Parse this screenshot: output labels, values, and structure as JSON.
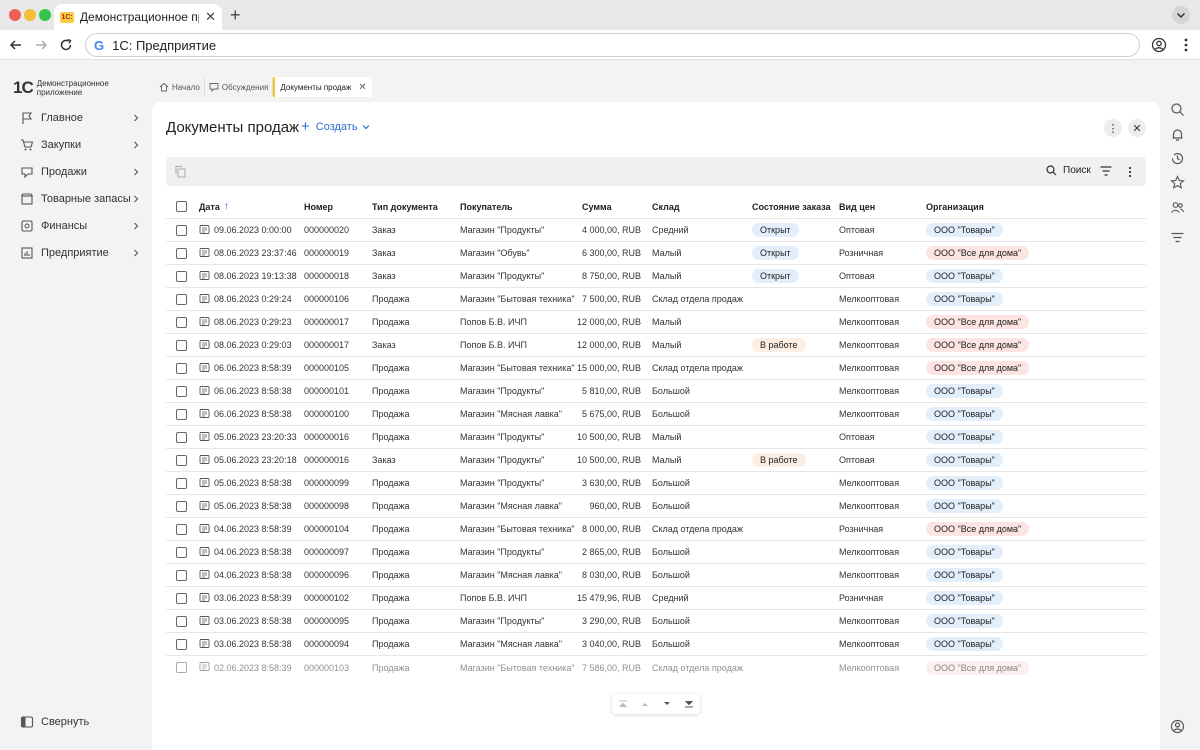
{
  "browser": {
    "tab_title": "Демонстрационное приложение",
    "favicon_text": "1С:",
    "url": "1С: Предприятие"
  },
  "sidebar": {
    "logo_mark": "1С",
    "logo_text": "Демонстрационное приложение",
    "items": [
      {
        "label": "Главное",
        "icon": "flag-icon"
      },
      {
        "label": "Закупки",
        "icon": "cart-icon"
      },
      {
        "label": "Продажи",
        "icon": "sales-icon"
      },
      {
        "label": "Товарные запасы",
        "icon": "box-icon"
      },
      {
        "label": "Финансы",
        "icon": "finance-icon"
      },
      {
        "label": "Предприятие",
        "icon": "chart-icon"
      }
    ],
    "collapse_label": "Свернуть"
  },
  "tabs": {
    "home": "Начало",
    "discussions": "Обсуждения",
    "current": "Документы продаж"
  },
  "main": {
    "title": "Документы продаж",
    "create_label": "Создать",
    "search_label": "Поиск"
  },
  "table": {
    "columns": [
      "Дата",
      "Номер",
      "Тип документа",
      "Покупатель",
      "Сумма",
      "Склад",
      "Состояние заказа",
      "Вид цен",
      "Организация"
    ],
    "rows": [
      {
        "date": "09.06.2023 0:00:00",
        "num": "000000020",
        "type": "Заказ",
        "buyer": "Магазин \"Продукты\"",
        "sum": "4 000,00, RUB",
        "store": "Средний",
        "state": "Открыт",
        "price": "Оптовая",
        "org": "ООО \"Товары\""
      },
      {
        "date": "08.06.2023 23:37:46",
        "num": "000000019",
        "type": "Заказ",
        "buyer": "Магазин \"Обувь\"",
        "sum": "6 300,00, RUB",
        "store": "Малый",
        "state": "Открыт",
        "price": "Розничная",
        "org": "ООО \"Все для дома\""
      },
      {
        "date": "08.06.2023 19:13:38",
        "num": "000000018",
        "type": "Заказ",
        "buyer": "Магазин \"Продукты\"",
        "sum": "8 750,00, RUB",
        "store": "Малый",
        "state": "Открыт",
        "price": "Оптовая",
        "org": "ООО \"Товары\""
      },
      {
        "date": "08.06.2023 0:29:24",
        "num": "000000106",
        "type": "Продажа",
        "buyer": "Магазин \"Бытовая техника\"",
        "sum": "7 500,00, RUB",
        "store": "Склад отдела продаж",
        "state": "",
        "price": "Мелкооптовая",
        "org": "ООО \"Товары\""
      },
      {
        "date": "08.06.2023 0:29:23",
        "num": "000000017",
        "type": "Продажа",
        "buyer": "Попов Б.В. ИЧП",
        "sum": "12 000,00, RUB",
        "store": "Малый",
        "state": "",
        "price": "Мелкооптовая",
        "org": "ООО \"Все для дома\""
      },
      {
        "date": "08.06.2023 0:29:03",
        "num": "000000017",
        "type": "Заказ",
        "buyer": "Попов Б.В. ИЧП",
        "sum": "12 000,00, RUB",
        "store": "Малый",
        "state": "В работе",
        "price": "Мелкооптовая",
        "org": "ООО \"Все для дома\""
      },
      {
        "date": "06.06.2023 8:58:39",
        "num": "000000105",
        "type": "Продажа",
        "buyer": "Магазин \"Бытовая техника\"",
        "sum": "15 000,00, RUB",
        "store": "Склад отдела продаж",
        "state": "",
        "price": "Мелкооптовая",
        "org": "ООО \"Все для дома\""
      },
      {
        "date": "06.06.2023 8:58:38",
        "num": "000000101",
        "type": "Продажа",
        "buyer": "Магазин \"Продукты\"",
        "sum": "5 810,00, RUB",
        "store": "Большой",
        "state": "",
        "price": "Мелкооптовая",
        "org": "ООО \"Товары\""
      },
      {
        "date": "06.06.2023 8:58:38",
        "num": "000000100",
        "type": "Продажа",
        "buyer": "Магазин \"Мясная лавка\"",
        "sum": "5 675,00, RUB",
        "store": "Большой",
        "state": "",
        "price": "Мелкооптовая",
        "org": "ООО \"Товары\""
      },
      {
        "date": "05.06.2023 23:20:33",
        "num": "000000016",
        "type": "Продажа",
        "buyer": "Магазин \"Продукты\"",
        "sum": "10 500,00, RUB",
        "store": "Малый",
        "state": "",
        "price": "Оптовая",
        "org": "ООО \"Товары\""
      },
      {
        "date": "05.06.2023 23:20:18",
        "num": "000000016",
        "type": "Заказ",
        "buyer": "Магазин \"Продукты\"",
        "sum": "10 500,00, RUB",
        "store": "Малый",
        "state": "В работе",
        "price": "Оптовая",
        "org": "ООО \"Товары\""
      },
      {
        "date": "05.06.2023 8:58:38",
        "num": "000000099",
        "type": "Продажа",
        "buyer": "Магазин \"Продукты\"",
        "sum": "3 630,00, RUB",
        "store": "Большой",
        "state": "",
        "price": "Мелкооптовая",
        "org": "ООО \"Товары\""
      },
      {
        "date": "05.06.2023 8:58:38",
        "num": "000000098",
        "type": "Продажа",
        "buyer": "Магазин \"Мясная лавка\"",
        "sum": "960,00, RUB",
        "store": "Большой",
        "state": "",
        "price": "Мелкооптовая",
        "org": "ООО \"Товары\""
      },
      {
        "date": "04.06.2023 8:58:39",
        "num": "000000104",
        "type": "Продажа",
        "buyer": "Магазин \"Бытовая техника\"",
        "sum": "8 000,00, RUB",
        "store": "Склад отдела продаж",
        "state": "",
        "price": "Розничная",
        "org": "ООО \"Все для дома\""
      },
      {
        "date": "04.06.2023 8:58:38",
        "num": "000000097",
        "type": "Продажа",
        "buyer": "Магазин \"Продукты\"",
        "sum": "2 865,00, RUB",
        "store": "Большой",
        "state": "",
        "price": "Мелкооптовая",
        "org": "ООО \"Товары\""
      },
      {
        "date": "04.06.2023 8:58:38",
        "num": "000000096",
        "type": "Продажа",
        "buyer": "Магазин \"Мясная лавка\"",
        "sum": "8 030,00, RUB",
        "store": "Большой",
        "state": "",
        "price": "Мелкооптовая",
        "org": "ООО \"Товары\""
      },
      {
        "date": "03.06.2023 8:58:39",
        "num": "000000102",
        "type": "Продажа",
        "buyer": "Попов Б.В. ИЧП",
        "sum": "15 479,96, RUB",
        "store": "Средний",
        "state": "",
        "price": "Розничная",
        "org": "ООО \"Товары\""
      },
      {
        "date": "03.06.2023 8:58:38",
        "num": "000000095",
        "type": "Продажа",
        "buyer": "Магазин \"Продукты\"",
        "sum": "3 290,00, RUB",
        "store": "Большой",
        "state": "",
        "price": "Мелкооптовая",
        "org": "ООО \"Товары\""
      },
      {
        "date": "03.06.2023 8:58:38",
        "num": "000000094",
        "type": "Продажа",
        "buyer": "Магазин \"Мясная лавка\"",
        "sum": "3 040,00, RUB",
        "store": "Большой",
        "state": "",
        "price": "Мелкооптовая",
        "org": "ООО \"Товары\""
      },
      {
        "date": "02.06.2023 8:58:39",
        "num": "000000103",
        "type": "Продажа",
        "buyer": "Магазин \"Бытовая техника\"",
        "sum": "7 586,00, RUB",
        "store": "Склад отдела продаж",
        "state": "",
        "price": "Мелкооптовая",
        "org": "ООО \"Все для дома\""
      }
    ]
  },
  "colors": {
    "accent": "#2d6fd1",
    "state_open": "#e2effb",
    "state_work": "#fdeee3",
    "org_home": "#fbe4e1",
    "org_goods": "#e2effb"
  }
}
